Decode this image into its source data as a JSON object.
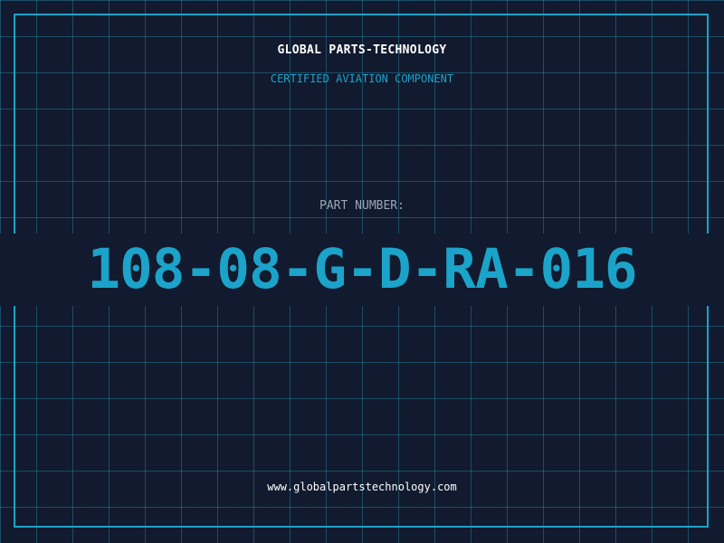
{
  "header": {
    "company": "GLOBAL PARTS-TECHNOLOGY",
    "subtitle": "CERTIFIED AVIATION COMPONENT"
  },
  "part": {
    "label": "PART NUMBER:",
    "number": "108-08-G-D-RA-016"
  },
  "footer": {
    "website": "www.globalpartstechnology.com"
  },
  "colors": {
    "background": "#111a2e",
    "accent": "#1ba3c9",
    "grid": "#298caa",
    "label": "#9aa7b8",
    "text": "#ffffff"
  }
}
